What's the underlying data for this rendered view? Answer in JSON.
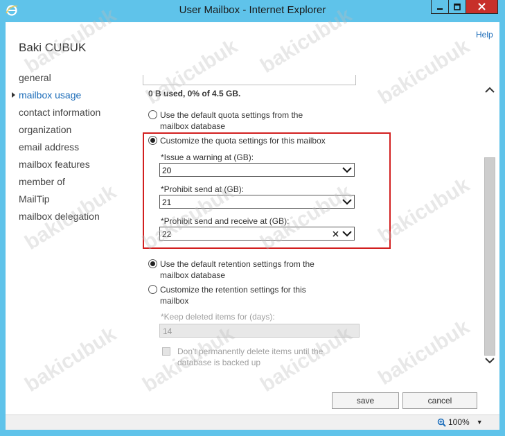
{
  "window": {
    "title": "User Mailbox - Internet Explorer",
    "icons": {
      "app": "internet-explorer-icon",
      "minimize": "minimize-icon",
      "maximize": "maximize-icon",
      "close": "close-icon"
    }
  },
  "header": {
    "help_label": "Help",
    "user_name": "Baki CUBUK"
  },
  "nav": {
    "items": [
      {
        "label": "general"
      },
      {
        "label": "mailbox usage"
      },
      {
        "label": "contact information"
      },
      {
        "label": "organization"
      },
      {
        "label": "email address"
      },
      {
        "label": "mailbox features"
      },
      {
        "label": "member of"
      },
      {
        "label": "MailTip"
      },
      {
        "label": "mailbox delegation"
      }
    ],
    "active_index": 1
  },
  "usage": {
    "used_text": "0 B used, 0% of 4.5 GB."
  },
  "quota": {
    "default_option": {
      "label": "Use the default quota settings from the mailbox database",
      "checked": false
    },
    "custom_option": {
      "label": "Customize the quota settings for this mailbox",
      "checked": true
    },
    "warning": {
      "label": "*Issue a warning at (GB):",
      "value": "20"
    },
    "prohibit_send": {
      "label": "*Prohibit send at (GB):",
      "value": "21"
    },
    "prohibit_send_receive": {
      "label": "*Prohibit send and receive at (GB):",
      "value": "22"
    }
  },
  "retention": {
    "default_option": {
      "label": "Use the default retention settings from the mailbox database",
      "checked": true
    },
    "custom_option": {
      "label": "Customize the retention settings for this mailbox",
      "checked": false
    },
    "keep_deleted": {
      "label": "*Keep deleted items for (days):",
      "value": "14"
    },
    "dont_delete_checkbox": {
      "label": "Don't permanently delete items until the database is backed up",
      "checked": false
    }
  },
  "buttons": {
    "save_label": "save",
    "cancel_label": "cancel"
  },
  "statusbar": {
    "zoom_level": "100%"
  },
  "watermark": {
    "text": "bakicubuk"
  },
  "colors": {
    "titlebar": "#5fc3ea",
    "accent": "#1a6bb8",
    "highlight_border": "#d21f1f",
    "close_button": "#c7302a"
  }
}
